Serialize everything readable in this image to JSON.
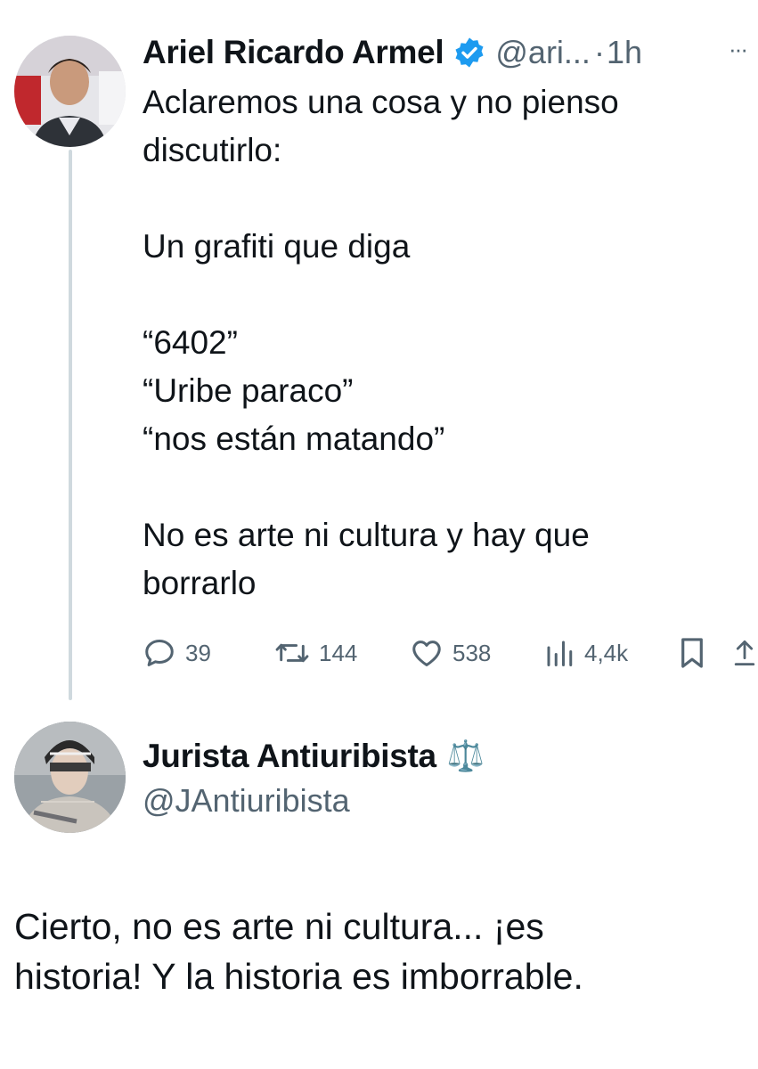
{
  "tweet": {
    "author_name": "Ariel Ricardo Armel",
    "author_handle": "@ari...",
    "separator": "·",
    "time": "1h",
    "more": "···",
    "text": "Aclaremos una cosa y no pienso\ndiscutirlo:\n\nUn grafiti que diga\n\n“6402”\n“Uribe paraco”\n“nos están matando”\n\nNo es arte ni cultura y hay que\nborrarlo",
    "stats": {
      "replies": "39",
      "retweets": "144",
      "likes": "538",
      "views": "4,4k"
    },
    "icons": [
      "avatar",
      "verified-badge-icon",
      "more-icon",
      "reply-icon",
      "retweet-icon",
      "like-icon",
      "views-icon",
      "bookmark-icon",
      "share-icon"
    ]
  },
  "reply": {
    "author_name": "Jurista Antiuribista",
    "author_emoji": "⚖️",
    "author_handle": "@JAntiuribista",
    "text": "Cierto, no es arte ni cultura... ¡es\nhistoria! Y la historia es imborrable."
  },
  "colors": {
    "text": "#0f1419",
    "secondary": "#536471",
    "verified": "#1d9bf0",
    "thread_line": "#cfd9de"
  }
}
